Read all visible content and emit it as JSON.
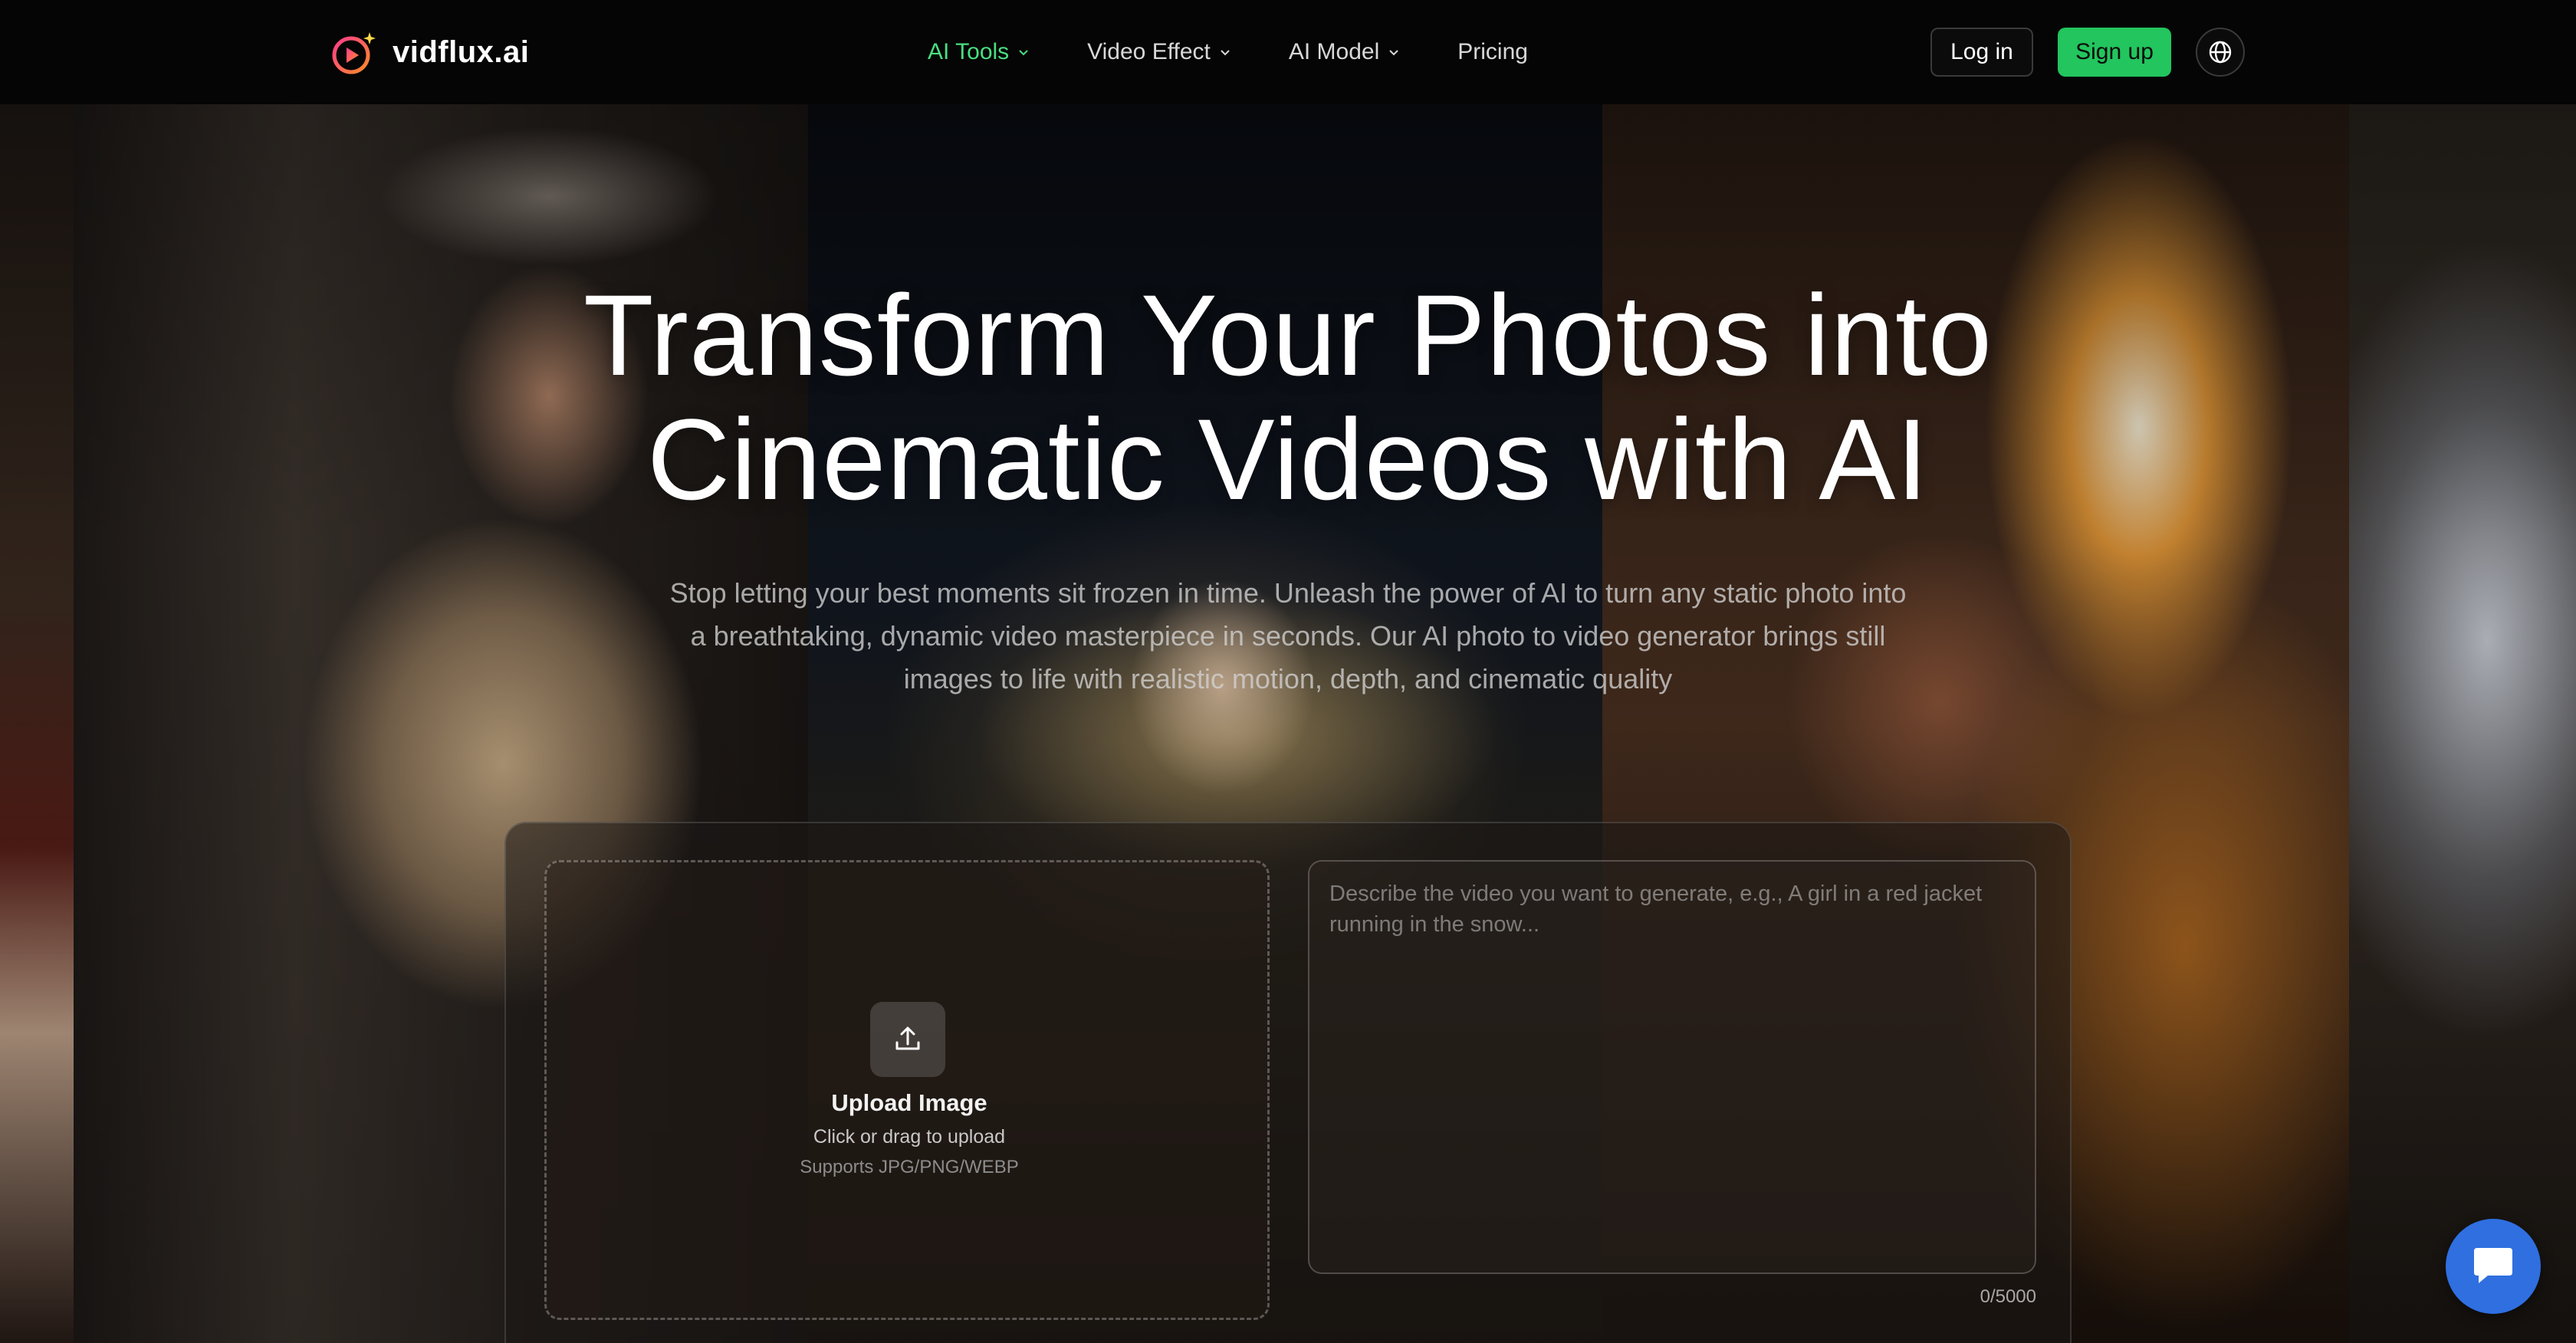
{
  "brand": {
    "name": "vidflux.ai"
  },
  "nav": {
    "items": [
      {
        "label": "AI Tools",
        "has_dropdown": true,
        "active": true
      },
      {
        "label": "Video Effect",
        "has_dropdown": true,
        "active": false
      },
      {
        "label": "AI Model",
        "has_dropdown": true,
        "active": false
      },
      {
        "label": "Pricing",
        "has_dropdown": false,
        "active": false
      }
    ],
    "login_label": "Log in",
    "signup_label": "Sign up",
    "language_icon": "globe-icon"
  },
  "hero": {
    "title_line1": "Transform Your Photos into",
    "title_line2": "Cinematic Videos with AI",
    "subtitle": "Stop letting your best moments sit frozen in time. Unleash the power of AI to turn any static photo into a breathtaking, dynamic video masterpiece in seconds. Our AI photo to video generator brings still images to life with realistic motion, depth, and cinematic quality"
  },
  "generator": {
    "upload_title": "Upload Image",
    "upload_sub": "Click or drag to upload",
    "upload_formats": "Supports JPG/PNG/WEBP",
    "prompt_placeholder": "Describe the video you want to generate, e.g., A girl in a red jacket running in the snow...",
    "prompt_value": "",
    "char_count": "0/5000"
  },
  "colors": {
    "accent": "#22c55e",
    "active_nav": "#4ade80",
    "chat": "#2f6fe0",
    "nav_bg": "#050505"
  }
}
